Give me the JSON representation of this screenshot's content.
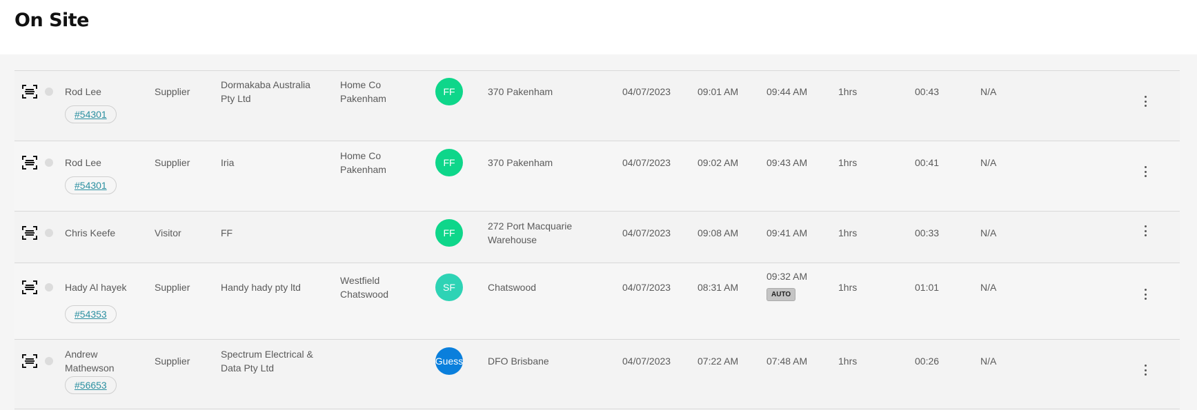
{
  "header": {
    "title": "On Site"
  },
  "rows": [
    {
      "name": "Rod Lee",
      "type": "Supplier",
      "company": [
        "Dormakaba Australia",
        "Pty Ltd"
      ],
      "location": [
        "Home Co",
        "Pakenham"
      ],
      "avatar": {
        "initials": "FF",
        "color": "#0ed68a"
      },
      "site": [
        "370 Pakenham"
      ],
      "date": "04/07/2023",
      "time_in": "09:01 AM",
      "time_out": "09:44 AM",
      "duration": "1hrs",
      "elapsed": "00:43",
      "extra": "N/A",
      "tag": "#54301"
    },
    {
      "name": "Rod Lee",
      "type": "Supplier",
      "company": [
        "Iria"
      ],
      "location": [
        "Home Co",
        "Pakenham"
      ],
      "avatar": {
        "initials": "FF",
        "color": "#0ed68a"
      },
      "site": [
        "370 Pakenham"
      ],
      "date": "04/07/2023",
      "time_in": "09:02 AM",
      "time_out": "09:43 AM",
      "duration": "1hrs",
      "elapsed": "00:41",
      "extra": "N/A",
      "tag": "#54301"
    },
    {
      "name": "Chris Keefe",
      "type": "Visitor",
      "company": [
        "FF"
      ],
      "location": [],
      "avatar": {
        "initials": "FF",
        "color": "#0ed68a"
      },
      "site": [
        "272 Port Macquarie",
        "Warehouse"
      ],
      "date": "04/07/2023",
      "time_in": "09:08 AM",
      "time_out": "09:41 AM",
      "duration": "1hrs",
      "elapsed": "00:33",
      "extra": "N/A",
      "tag": null
    },
    {
      "name": "Hady Al hayek",
      "type": "Supplier",
      "company": [
        "Handy hady pty ltd"
      ],
      "location": [
        "Westfield",
        "Chatswood"
      ],
      "avatar": {
        "initials": "SF",
        "color": "#2ed3b5"
      },
      "site": [
        "Chatswood"
      ],
      "date": "04/07/2023",
      "time_in": "08:31 AM",
      "time_out": "09:32 AM",
      "time_out_badge": "AUTO",
      "duration": "1hrs",
      "elapsed": "01:01",
      "extra": "N/A",
      "tag": "#54353"
    },
    {
      "name": "Andrew Mathewson",
      "name_lines": [
        "Andrew",
        "Mathewson"
      ],
      "type": "Supplier",
      "company": [
        "Spectrum Electrical &",
        "Data Pty Ltd"
      ],
      "location": [],
      "avatar": {
        "initials": "Guess",
        "color": "#0a7fdc"
      },
      "site": [
        "DFO Brisbane"
      ],
      "date": "04/07/2023",
      "time_in": "07:22 AM",
      "time_out": "07:48 AM",
      "duration": "1hrs",
      "elapsed": "00:26",
      "extra": "N/A",
      "tag": "#56653"
    }
  ]
}
